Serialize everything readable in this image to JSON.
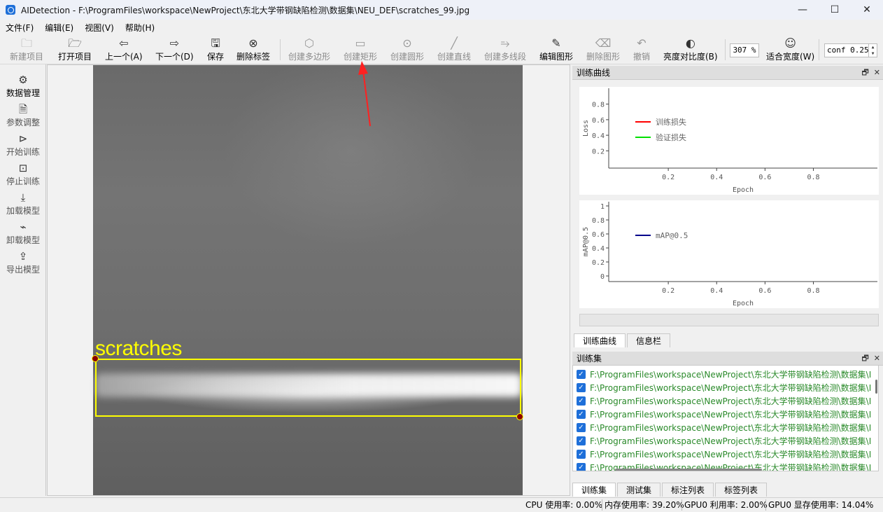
{
  "window": {
    "title": "AIDetection - F:\\ProgramFiles\\workspace\\NewProject\\东北大学带钢缺陷检测\\数据集\\NEU_DEF\\scratches_99.jpg",
    "controls": [
      "—",
      "☐",
      "✕"
    ]
  },
  "menu": [
    "文件(F)",
    "编辑(E)",
    "视图(V)",
    "帮助(H)"
  ],
  "toolbar": {
    "new_project": "新建项目",
    "open_project": "打开项目",
    "prev": "上一个(A)",
    "next": "下一个(D)",
    "save": "保存",
    "delete_label": "删除标签",
    "create_polygon": "创建多边形",
    "create_rect": "创建矩形",
    "create_circle": "创建圆形",
    "create_line": "创建直线",
    "create_polyline": "创建多线段",
    "edit_shape": "编辑图形",
    "delete_shape": "删除图形",
    "undo": "撤销",
    "brightness": "亮度对比度(B)",
    "zoom": "307 %",
    "fit_width": "适合宽度(W)",
    "conf": "conf 0.25"
  },
  "sidebar": [
    "数据管理",
    "参数调整",
    "开始训练",
    "停止训练",
    "加载模型",
    "卸载模型",
    "导出模型"
  ],
  "annotation": {
    "label": "scratches",
    "color": "#ffff00"
  },
  "panels": {
    "training_curve_title": "训练曲线",
    "dataset_title": "训练集"
  },
  "chart_data": [
    {
      "type": "line",
      "xlabel": "Epoch",
      "ylabel": "Loss",
      "x_ticks": [
        "0.2",
        "0.4",
        "0.6",
        "0.8"
      ],
      "y_ticks": [
        "0.2",
        "0.4",
        "0.6",
        "0.8"
      ],
      "series": [
        {
          "name": "训练损失",
          "color": "#ff0000",
          "values": []
        },
        {
          "name": "验证损失",
          "color": "#00e000",
          "values": []
        }
      ]
    },
    {
      "type": "line",
      "xlabel": "Epoch",
      "ylabel": "mAP@0.5",
      "x_ticks": [
        "0.2",
        "0.4",
        "0.6",
        "0.8"
      ],
      "y_ticks": [
        "0",
        "0.2",
        "0.4",
        "0.6",
        "0.8",
        "1"
      ],
      "series": [
        {
          "name": "mAP@0.5",
          "color": "#00008b",
          "values": []
        }
      ]
    }
  ],
  "chart_tabs": [
    "训练曲线",
    "信息栏"
  ],
  "files": [
    "F:\\ProgramFiles\\workspace\\NewProject\\东北大学带钢缺陷检测\\数据集\\I",
    "F:\\ProgramFiles\\workspace\\NewProject\\东北大学带钢缺陷检测\\数据集\\I",
    "F:\\ProgramFiles\\workspace\\NewProject\\东北大学带钢缺陷检测\\数据集\\I",
    "F:\\ProgramFiles\\workspace\\NewProject\\东北大学带钢缺陷检测\\数据集\\I",
    "F:\\ProgramFiles\\workspace\\NewProject\\东北大学带钢缺陷检测\\数据集\\I",
    "F:\\ProgramFiles\\workspace\\NewProject\\东北大学带钢缺陷检测\\数据集\\I",
    "F:\\ProgramFiles\\workspace\\NewProject\\东北大学带钢缺陷检测\\数据集\\I",
    "F:\\ProgramFiles\\workspace\\NewProject\\东北大学带钢缺陷检测\\数据集\\I"
  ],
  "bottom_tabs": [
    "训练集",
    "测试集",
    "标注列表",
    "标签列表"
  ],
  "status": {
    "cpu": "CPU 使用率: 0.00%",
    "mem": "内存使用率: 39.20%",
    "gpu": "GPU0 利用率: 2.00%",
    "gpu_mem": "GPU0 显存使用率: 14.04%"
  }
}
